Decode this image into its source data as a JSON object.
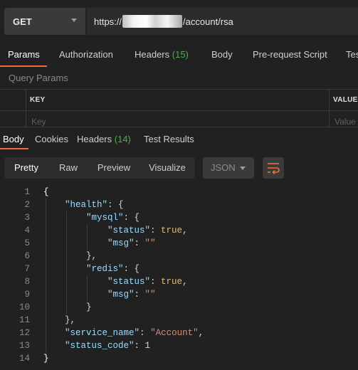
{
  "request": {
    "method": "GET",
    "url_prefix": "https://",
    "url_suffix": "/account/rsa"
  },
  "request_tabs": [
    {
      "label": "Params",
      "count": "",
      "active": true
    },
    {
      "label": "Authorization",
      "count": ""
    },
    {
      "label": "Headers",
      "count": "(15)"
    },
    {
      "label": "Body",
      "count": ""
    },
    {
      "label": "Pre-request Script",
      "count": ""
    },
    {
      "label": "Tes",
      "count": ""
    }
  ],
  "query_params": {
    "title": "Query Params",
    "col_key": "KEY",
    "col_value": "VALUE",
    "key_placeholder": "Key",
    "value_placeholder": "Value"
  },
  "response_tabs": [
    {
      "label": "Body",
      "count": "",
      "active": true
    },
    {
      "label": "Cookies",
      "count": ""
    },
    {
      "label": "Headers",
      "count": "(14)"
    },
    {
      "label": "Test Results",
      "count": ""
    }
  ],
  "view_modes": [
    "Pretty",
    "Raw",
    "Preview",
    "Visualize"
  ],
  "active_view": "Pretty",
  "format": "JSON",
  "colors": {
    "accent": "#f26b3a",
    "count": "#4caf50"
  },
  "code_lines": [
    {
      "n": "1",
      "text": "{"
    },
    {
      "n": "2",
      "text": "    \"health\": {"
    },
    {
      "n": "3",
      "text": "        \"mysql\": {"
    },
    {
      "n": "4",
      "text": "            \"status\": true,"
    },
    {
      "n": "5",
      "text": "            \"msg\": \"\""
    },
    {
      "n": "6",
      "text": "        },"
    },
    {
      "n": "7",
      "text": "        \"redis\": {"
    },
    {
      "n": "8",
      "text": "            \"status\": true,"
    },
    {
      "n": "9",
      "text": "            \"msg\": \"\""
    },
    {
      "n": "10",
      "text": "        }"
    },
    {
      "n": "11",
      "text": "    },"
    },
    {
      "n": "12",
      "text": "    \"service_name\": \"Account\","
    },
    {
      "n": "13",
      "text": "    \"status_code\": 1"
    },
    {
      "n": "14",
      "text": "}"
    }
  ]
}
